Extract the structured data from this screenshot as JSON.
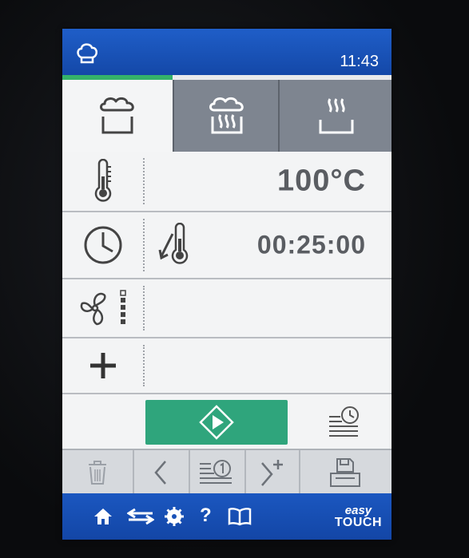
{
  "header": {
    "time": "11:43",
    "chef_icon": "chef-hat-icon"
  },
  "mode_tabs": [
    {
      "name": "steam-mode-icon",
      "active": true
    },
    {
      "name": "combi-mode-icon",
      "active": false
    },
    {
      "name": "convection-mode-icon",
      "active": false
    }
  ],
  "temperature": {
    "value": "100°C",
    "icon": "thermometer-icon"
  },
  "timer": {
    "value": "00:25:00",
    "icon": "clock-icon",
    "sub_icon": "core-probe-icon"
  },
  "fan": {
    "icon": "fan-icon",
    "level": 4,
    "max_level": 5
  },
  "extras": {
    "icon": "plus-icon"
  },
  "start": {
    "icon": "play-icon",
    "schedule_icon": "delayed-start-icon"
  },
  "toolbar": [
    "trash-icon",
    "back-arrow-icon",
    "step-one-icon",
    "add-step-icon",
    "save-icon"
  ],
  "bottom_nav": [
    "home-icon",
    "return-icon",
    "settings-icon",
    "help-icon",
    "manual-icon"
  ],
  "bottom_labels": {
    "help": "?"
  },
  "brand": {
    "line1": "easy",
    "line2": "TOUCH"
  },
  "colors": {
    "header_blue": "#1f5ec8",
    "start_green": "#2fa57c",
    "progress_green": "#35b26a",
    "text_gray": "#5a5d62"
  }
}
